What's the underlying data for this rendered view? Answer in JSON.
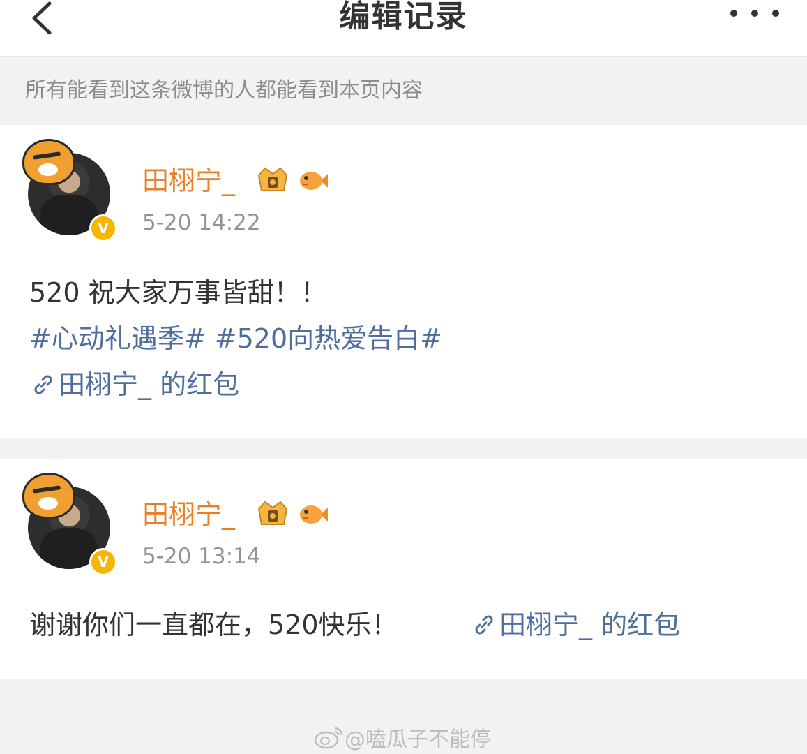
{
  "header": {
    "title": "编辑记录",
    "back_icon": "chevron-left-icon",
    "more_icon": "ellipsis-icon"
  },
  "notice": "所有能看到这条微博的人都能看到本页内容",
  "colors": {
    "username": "#ec7d22",
    "link": "#4f6e9e",
    "text": "#333333",
    "meta": "#939393",
    "background": "#f2f2f2"
  },
  "records": [
    {
      "username": "田栩宁_",
      "time": "5-20 14:22",
      "content": "520 祝大家万事皆甜！！",
      "topics": "#心动礼遇季# #520向热爱告白#",
      "link_text": "田栩宁_ 的红包"
    },
    {
      "username": "田栩宁_",
      "time": "5-20 13:14",
      "content": "谢谢你们一直都在，520快乐！",
      "link_text": "田栩宁_ 的红包"
    }
  ],
  "footer": {
    "watermark": "@嗑瓜子不能停"
  }
}
